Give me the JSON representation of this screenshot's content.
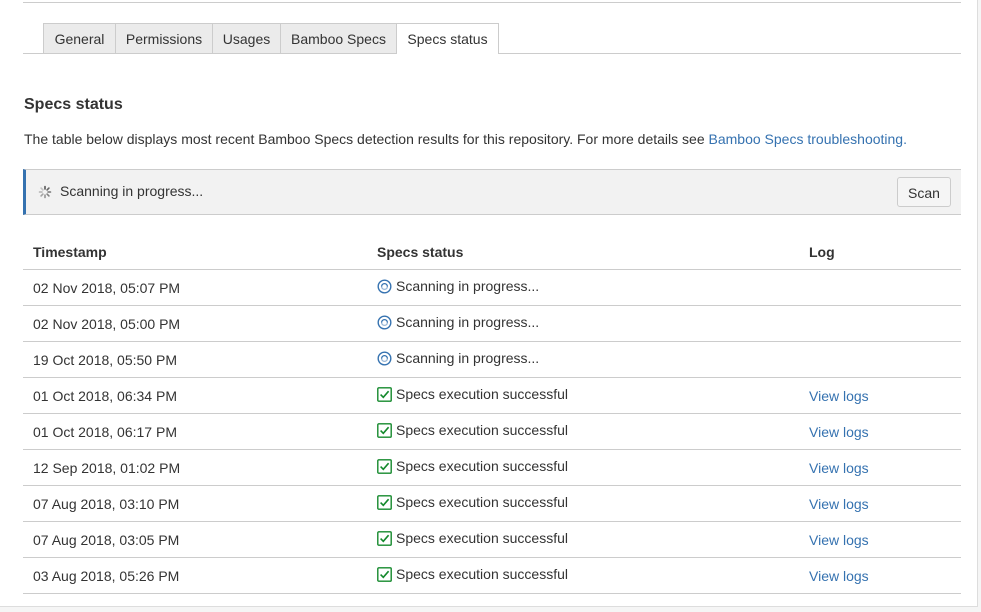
{
  "tabs": [
    {
      "label": "General",
      "active": false
    },
    {
      "label": "Permissions",
      "active": false
    },
    {
      "label": "Usages",
      "active": false
    },
    {
      "label": "Bamboo Specs",
      "active": false
    },
    {
      "label": "Specs status",
      "active": true
    }
  ],
  "section": {
    "title": "Specs status",
    "intro_text": "The table below displays most recent Bamboo Specs detection results for this repository. For more details see ",
    "intro_link": "Bamboo Specs troubleshooting."
  },
  "scan_bar": {
    "status_text": "Scanning in progress...",
    "button_label": "Scan"
  },
  "table": {
    "headers": {
      "timestamp": "Timestamp",
      "status": "Specs status",
      "log": "Log"
    },
    "rows": [
      {
        "timestamp": "02 Nov 2018, 05:07 PM",
        "status": "Scanning in progress...",
        "icon": "scanning-icon",
        "log": ""
      },
      {
        "timestamp": "02 Nov 2018, 05:00 PM",
        "status": "Scanning in progress...",
        "icon": "scanning-icon",
        "log": ""
      },
      {
        "timestamp": "19 Oct 2018, 05:50 PM",
        "status": "Scanning in progress...",
        "icon": "scanning-icon",
        "log": ""
      },
      {
        "timestamp": "01 Oct 2018, 06:34 PM",
        "status": "Specs execution successful",
        "icon": "success-check-icon",
        "log": "View logs"
      },
      {
        "timestamp": "01 Oct 2018, 06:17 PM",
        "status": "Specs execution successful",
        "icon": "success-check-icon",
        "log": "View logs"
      },
      {
        "timestamp": "12 Sep 2018, 01:02 PM",
        "status": "Specs execution successful",
        "icon": "success-check-icon",
        "log": "View logs"
      },
      {
        "timestamp": "07 Aug 2018, 03:10 PM",
        "status": "Specs execution successful",
        "icon": "success-check-icon",
        "log": "View logs"
      },
      {
        "timestamp": "07 Aug 2018, 03:05 PM",
        "status": "Specs execution successful",
        "icon": "success-check-icon",
        "log": "View logs"
      },
      {
        "timestamp": "03 Aug 2018, 05:26 PM",
        "status": "Specs execution successful",
        "icon": "success-check-icon",
        "log": "View logs"
      }
    ]
  },
  "colors": {
    "link": "#3572b0",
    "success": "#14892c",
    "scanning": "#3572b0",
    "accent_border": "#3572b0"
  }
}
